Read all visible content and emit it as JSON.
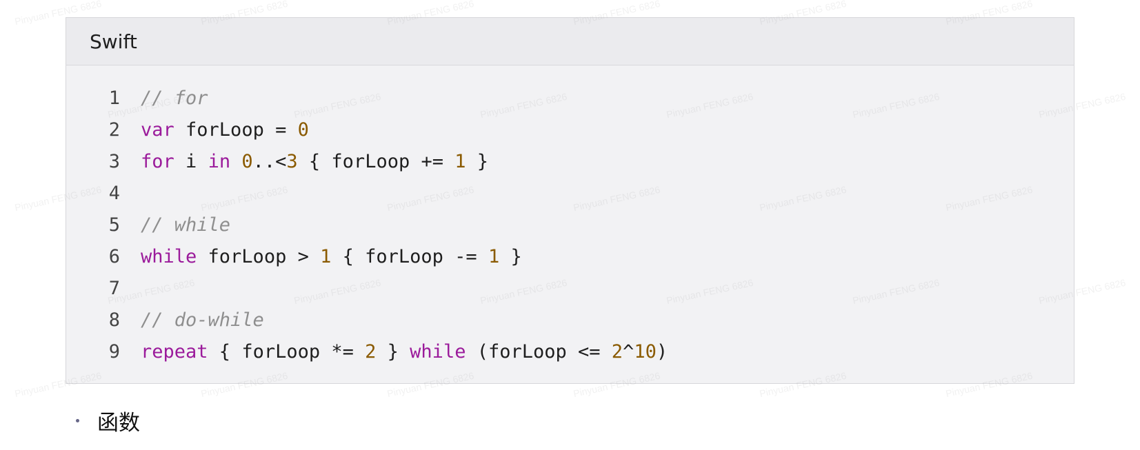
{
  "code_block": {
    "language": "Swift",
    "lines": [
      {
        "num": "1",
        "tokens": [
          {
            "t": "comment",
            "v": "// for"
          }
        ]
      },
      {
        "num": "2",
        "tokens": [
          {
            "t": "keyword",
            "v": "var"
          },
          {
            "t": "plain",
            "v": " forLoop = "
          },
          {
            "t": "number",
            "v": "0"
          }
        ]
      },
      {
        "num": "3",
        "tokens": [
          {
            "t": "keyword",
            "v": "for"
          },
          {
            "t": "plain",
            "v": " i "
          },
          {
            "t": "keyword",
            "v": "in"
          },
          {
            "t": "plain",
            "v": " "
          },
          {
            "t": "number",
            "v": "0"
          },
          {
            "t": "plain",
            "v": "..<"
          },
          {
            "t": "number",
            "v": "3"
          },
          {
            "t": "plain",
            "v": " { forLoop += "
          },
          {
            "t": "number",
            "v": "1"
          },
          {
            "t": "plain",
            "v": " }"
          }
        ]
      },
      {
        "num": "4",
        "tokens": []
      },
      {
        "num": "5",
        "tokens": [
          {
            "t": "comment",
            "v": "// while"
          }
        ]
      },
      {
        "num": "6",
        "tokens": [
          {
            "t": "keyword",
            "v": "while"
          },
          {
            "t": "plain",
            "v": " forLoop > "
          },
          {
            "t": "number",
            "v": "1"
          },
          {
            "t": "plain",
            "v": " { forLoop -= "
          },
          {
            "t": "number",
            "v": "1"
          },
          {
            "t": "plain",
            "v": " }"
          }
        ]
      },
      {
        "num": "7",
        "tokens": []
      },
      {
        "num": "8",
        "tokens": [
          {
            "t": "comment",
            "v": "// do-while"
          }
        ]
      },
      {
        "num": "9",
        "tokens": [
          {
            "t": "keyword",
            "v": "repeat"
          },
          {
            "t": "plain",
            "v": " { forLoop *= "
          },
          {
            "t": "number",
            "v": "2"
          },
          {
            "t": "plain",
            "v": " } "
          },
          {
            "t": "keyword",
            "v": "while"
          },
          {
            "t": "plain",
            "v": " (forLoop <= "
          },
          {
            "t": "number",
            "v": "2"
          },
          {
            "t": "plain",
            "v": "^"
          },
          {
            "t": "number",
            "v": "10"
          },
          {
            "t": "plain",
            "v": ")"
          }
        ]
      }
    ]
  },
  "bullet": {
    "text": "函数"
  },
  "watermark": {
    "text": "Pinyuan FENG 6826"
  },
  "colors": {
    "keyword": "#9b1b9b",
    "number": "#8a5a00",
    "comment": "#8e8e8e"
  }
}
